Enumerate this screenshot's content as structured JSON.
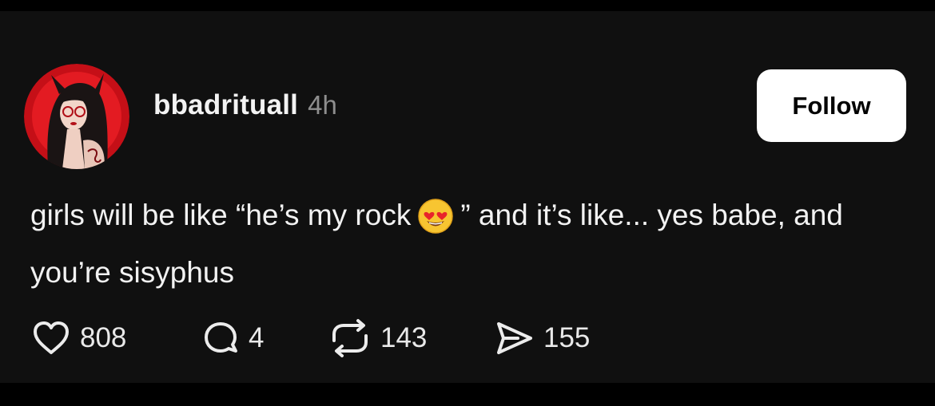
{
  "post": {
    "username": "bbadrituall",
    "timestamp": "4h",
    "follow_label": "Follow",
    "text_before_emoji": "girls will be like “he’s my rock",
    "emoji_icon": "smiling-face-with-heart-eyes-icon",
    "text_after_emoji": "” and it’s like... yes babe, and you’re sisyphus",
    "actions": {
      "like": {
        "icon": "heart-icon",
        "count": "808"
      },
      "reply": {
        "icon": "comment-bubble-icon",
        "count": "4"
      },
      "repost": {
        "icon": "repost-icon",
        "count": "143"
      },
      "share": {
        "icon": "send-icon",
        "count": "155"
      }
    }
  },
  "colors": {
    "background": "#000000",
    "card": "#101010",
    "text": "#f2f2f2",
    "muted": "#8e8e8e",
    "button_bg": "#ffffff",
    "button_text": "#000000",
    "avatar_accent": "#d0121b"
  }
}
